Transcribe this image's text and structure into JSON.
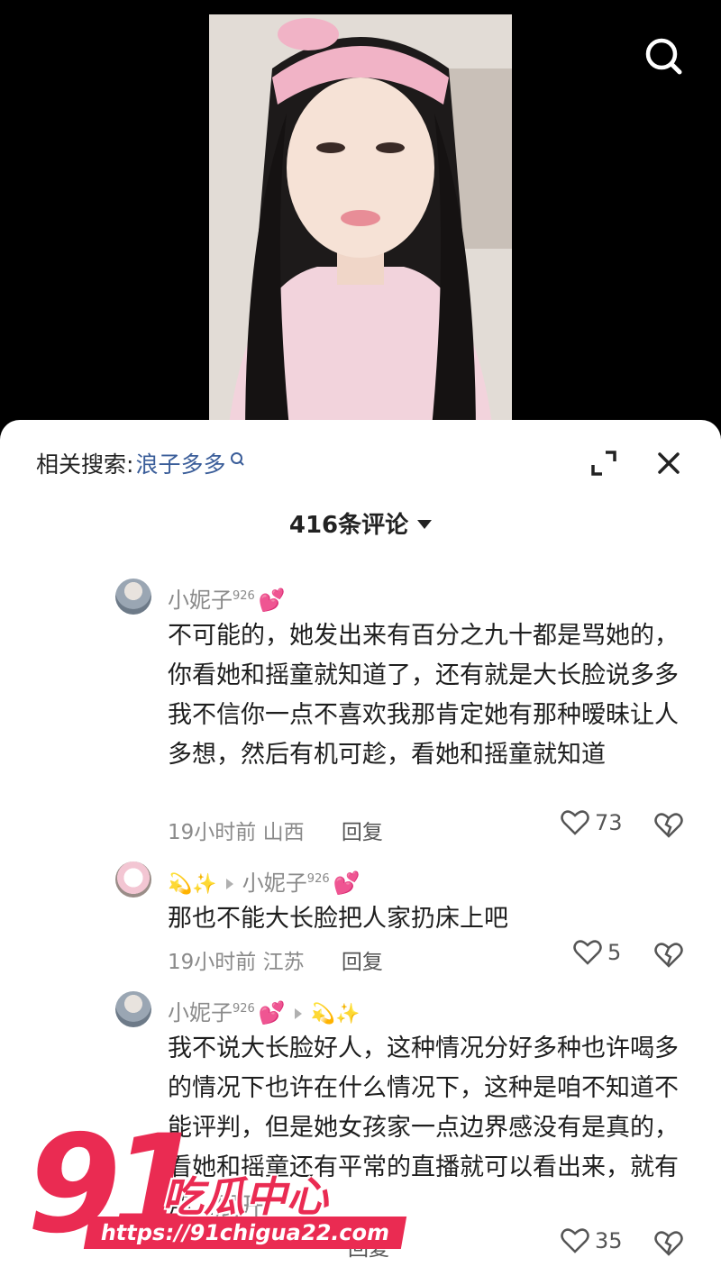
{
  "related_search": {
    "label": "相关搜索:",
    "keyword": "浪子多多"
  },
  "comment_count": "416条评论",
  "comments": [
    {
      "username": "小妮子",
      "username_sup": "926",
      "text": "不可能的，她发出来有百分之九十都是骂她的，你看她和摇童就知道了，还有就是大长脸说多多我不信你一点不喜欢我那肯定她有那种暧昧让人多想，然后有机可趁，看她和摇童就知道",
      "time": "19小时前",
      "location": "山西",
      "reply_label": "回复",
      "likes": "73"
    },
    {
      "username": "💫✨",
      "reply_to": "小妮子",
      "reply_to_sup": "926",
      "text": "那也不能大长脸把人家扔床上吧",
      "time": "19小时前",
      "location": "江苏",
      "reply_label": "回复",
      "likes": "5"
    },
    {
      "username": "小妮子",
      "username_sup": "926",
      "reply_to": "💫✨",
      "text": "我不说大长脸好人，这种情况分好多种也许喝多的情况下也许在什么情况下，这种是咱不知道不能评判，但是她女孩家一点边界感没有是真的，看她和摇童还有平常的直播就可以看出来，就有那...",
      "expand_label": "展开",
      "reply_label": "回复",
      "likes": "35"
    }
  ],
  "watermark": {
    "number": "91",
    "title": "吃瓜中心",
    "url": "https://91chigua22.com"
  },
  "colors": {
    "accent": "#ea2b52",
    "link": "#3a5d99",
    "muted": "#8a8a8a"
  },
  "icons": [
    "search-icon",
    "expand-icon",
    "close-icon",
    "heart-icon",
    "broken-heart-icon",
    "dropdown-caret-icon"
  ]
}
